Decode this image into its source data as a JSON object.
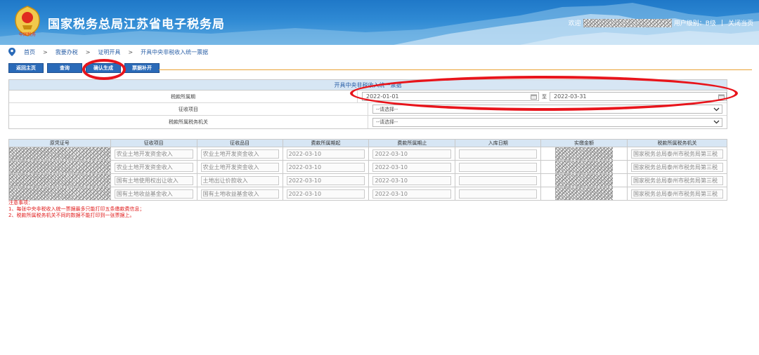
{
  "header": {
    "site_title": "国家税务总局江苏省电子税务局",
    "welcome": "欢迎",
    "user_level": "用户级别：B级",
    "separator": "|",
    "close_page": "关闭当页",
    "logo_caption": "中国税务"
  },
  "breadcrumb": {
    "items": [
      "首页",
      "我要办税",
      "证明开具",
      "开具中央非税收入统一票据"
    ],
    "arrow": ">"
  },
  "toolbar": {
    "buttons": [
      "返回主页",
      "查询",
      "确认生成",
      "票据补开"
    ]
  },
  "form": {
    "title": "开具中央非税收入统一票据",
    "rows": {
      "period_label": "税款所属期",
      "date_from": "2022-01-01",
      "to_label": "至",
      "date_to": "2022-03-31",
      "item_label": "征收项目",
      "item_value": "--请选择--",
      "authority_label": "税款所属税务机关",
      "authority_value": "--请选择--"
    }
  },
  "table": {
    "columns": [
      "原凭证号",
      "征收项目",
      "征收品目",
      "费款所属期起",
      "费款所属期止",
      "入库日期",
      "实缴金额",
      "税款所属税务机关"
    ],
    "rows": [
      {
        "item": "农业土地开发资金收入",
        "subitem": "农业土地开发资金收入",
        "start": "2022-03-10",
        "end": "2022-03-10",
        "date": "",
        "authority": "国家税务总局泰州市税务局第三税"
      },
      {
        "item": "农业土地开发资金收入",
        "subitem": "农业土地开发资金收入",
        "start": "2022-03-10",
        "end": "2022-03-10",
        "date": "",
        "authority": "国家税务总局泰州市税务局第三税"
      },
      {
        "item": "国有土地使用权出让收入",
        "subitem": "土地出让价款收入",
        "start": "2022-03-10",
        "end": "2022-03-10",
        "date": "",
        "authority": "国家税务总局泰州市税务局第三税"
      },
      {
        "item": "国有土地收益基金收入",
        "subitem": "国有土地收益基金收入",
        "start": "2022-03-10",
        "end": "2022-03-10",
        "date": "",
        "authority": "国家税务总局泰州市税务局第三税"
      }
    ]
  },
  "notes": {
    "title": "注意事项：",
    "items": [
      "1、每张中央非税收入统一票据最多只能打印五条缴款费信息；",
      "2、税款所属税务机关不同的数据不能打印到一张票据上。"
    ]
  },
  "colors": {
    "banner": "#2f8ad4",
    "button": "#2a6ab8",
    "highlight": "#e8141b",
    "note": "#e01b1b"
  },
  "icons": [
    "location-pin-icon",
    "calendar-icon",
    "chevron-down-icon",
    "tax-emblem-logo"
  ]
}
